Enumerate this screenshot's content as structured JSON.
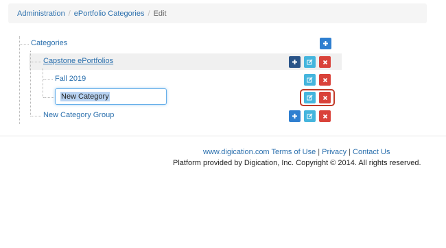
{
  "breadcrumb": {
    "items": [
      "Administration",
      "ePortfolio Categories"
    ],
    "current": "Edit",
    "separator": "/"
  },
  "tree": {
    "root_label": "Categories",
    "nodes": [
      {
        "label": "Capstone ePortfolios"
      },
      {
        "label": "Fall 2019"
      },
      {
        "label": "New Category Group"
      }
    ],
    "edit_input_value": "New Category"
  },
  "footer": {
    "links": [
      "www.digication.com Terms of Use",
      "Privacy",
      "Contact Us"
    ],
    "link_separator": "|",
    "copyright": "Platform provided by Digication, Inc. Copyright © 2014. All rights reserved."
  },
  "colors": {
    "link": "#2a6fad",
    "add_button": "#2f7fd0",
    "edit_button": "#45b5dd",
    "delete_button": "#d9423a",
    "focus_ring": "#c23a27"
  },
  "icons": {
    "add": "plus-icon",
    "edit": "edit-icon",
    "delete": "close-icon"
  }
}
